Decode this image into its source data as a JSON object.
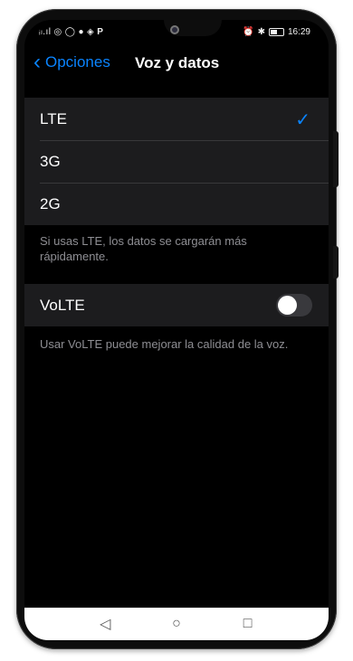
{
  "status_bar": {
    "left_text": "ᵢₗ.ıl",
    "time": "16:29"
  },
  "nav": {
    "back_label": "Opciones",
    "title": "Voz y datos"
  },
  "network_options": [
    {
      "label": "LTE",
      "selected": true
    },
    {
      "label": "3G",
      "selected": false
    },
    {
      "label": "2G",
      "selected": false
    }
  ],
  "network_footer": "Si usas LTE, los datos se cargarán más rápidamente.",
  "volte": {
    "label": "VoLTE",
    "enabled": false,
    "footer": "Usar VoLTE puede mejorar la calidad de la voz."
  },
  "colors": {
    "accent": "#0a84ff",
    "background": "#000000",
    "cell": "#1c1c1e"
  },
  "icons": {
    "check": "✓",
    "back": "‹",
    "nav_back": "◁",
    "nav_home": "○",
    "nav_recent": "□"
  }
}
